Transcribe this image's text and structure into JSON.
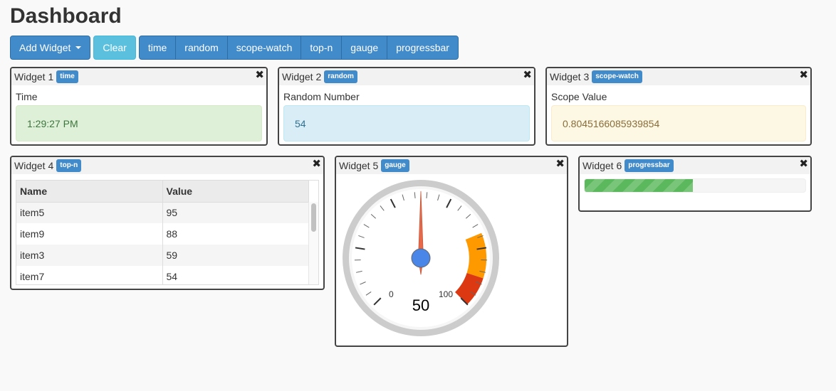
{
  "page": {
    "title": "Dashboard"
  },
  "toolbar": {
    "add_widget_label": "Add Widget",
    "clear_label": "Clear",
    "widget_types": [
      "time",
      "random",
      "scope-watch",
      "top-n",
      "gauge",
      "progressbar"
    ]
  },
  "widgets": {
    "w1": {
      "title": "Widget 1",
      "badge": "time",
      "label": "Time",
      "value": "1:29:27 PM"
    },
    "w2": {
      "title": "Widget 2",
      "badge": "random",
      "label": "Random Number",
      "value": "54"
    },
    "w3": {
      "title": "Widget 3",
      "badge": "scope-watch",
      "label": "Scope Value",
      "value": "0.8045166085939854"
    },
    "w4": {
      "title": "Widget 4",
      "badge": "top-n",
      "columns": [
        "Name",
        "Value"
      ],
      "rows": [
        {
          "name": "item5",
          "value": "95"
        },
        {
          "name": "item9",
          "value": "88"
        },
        {
          "name": "item3",
          "value": "59"
        },
        {
          "name": "item7",
          "value": "54"
        }
      ]
    },
    "w5": {
      "title": "Widget 5",
      "badge": "gauge",
      "min_label": "0",
      "max_label": "100",
      "value": 50,
      "value_text": "50"
    },
    "w6": {
      "title": "Widget 6",
      "badge": "progressbar",
      "progress": 0.49
    }
  },
  "icons": {
    "close": "close-icon",
    "caret": "caret-down-icon"
  },
  "colors": {
    "primary": "#428bca",
    "info": "#5bc0de",
    "success_bg": "#dff0d8",
    "info_bg": "#d9edf7",
    "warning_bg": "#fcf8e3",
    "gauge_yellow": "#ff9900",
    "gauge_red": "#dc3912",
    "needle": "#e8694a",
    "needle_hub": "#4a86e8",
    "progress": "#5cb85c"
  }
}
